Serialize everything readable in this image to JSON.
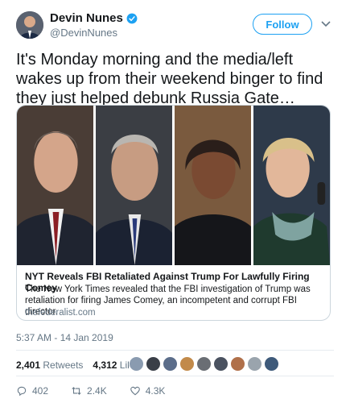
{
  "user": {
    "name": "Devin Nunes",
    "handle": "@DevinNunes",
    "follow_label": "Follow"
  },
  "tweet": {
    "text": "It's Monday morning and the media/left wakes up from their weekend binger to find they just helped debunk Russia Gate…",
    "timestamp": "5:37 AM - 14 Jan 2019"
  },
  "card": {
    "title": "NYT Reveals FBI Retaliated Against Trump For Lawfully Firing Comey",
    "description": "The New York Times revealed that the FBI investigation of Trump was retaliation for firing James Comey, an incompetent and corrupt FBI director.",
    "domain": "thefederalist.com"
  },
  "stats": {
    "retweets_count": "2,401",
    "retweets_label": "Retweets",
    "likes_count": "4,312",
    "likes_label": "Likes"
  },
  "actions": {
    "replies": "402",
    "retweets": "2.4K",
    "likes": "4.3K"
  },
  "colors": {
    "accent": "#1da1f2",
    "text": "#14171a",
    "muted": "#657786"
  }
}
